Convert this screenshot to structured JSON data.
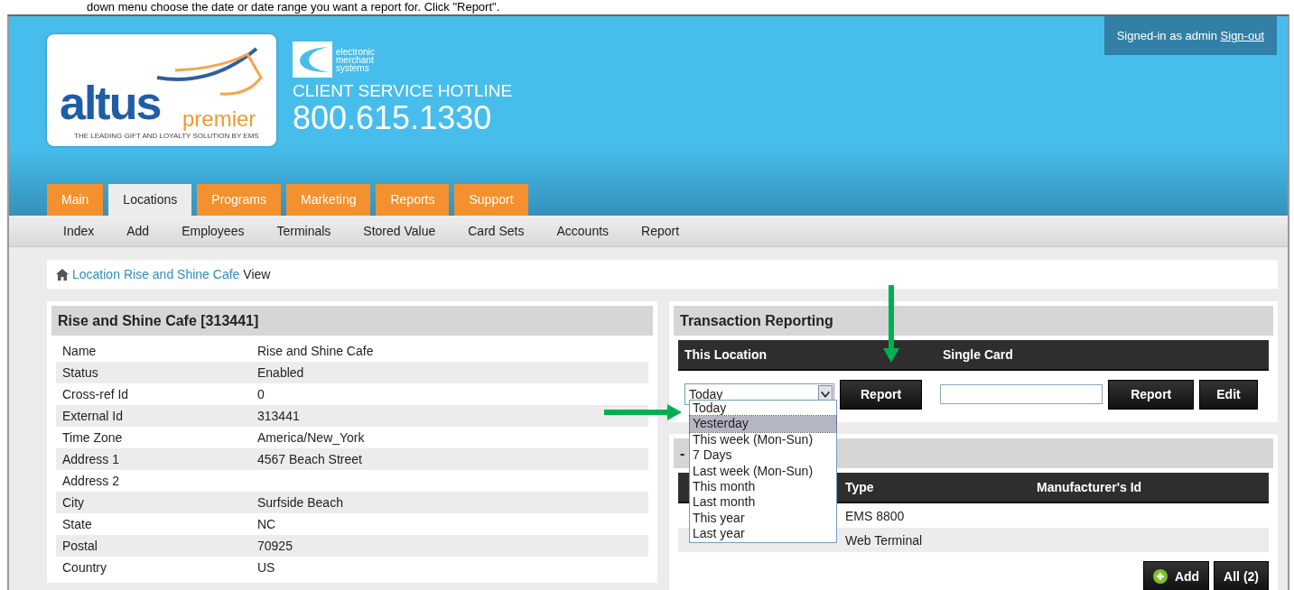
{
  "instruction_line": "down menu choose the date or date range you want a report for. Click \"Report\".",
  "header": {
    "logo": {
      "word": "altus",
      "suffix": "premier",
      "tagline": "THE LEADING GIFT AND LOYALTY SOLUTION BY EMS"
    },
    "partner": {
      "lines": [
        "electronic",
        "merchant",
        "systems"
      ],
      "hotline_label": "CLIENT SERVICE HOTLINE",
      "hotline_number": "800.615.1330"
    },
    "session": {
      "text": "Signed-in as admin",
      "link": "Sign-out"
    }
  },
  "tabs": [
    {
      "label": "Main",
      "selected": false
    },
    {
      "label": "Locations",
      "selected": true
    },
    {
      "label": "Programs",
      "selected": false
    },
    {
      "label": "Marketing",
      "selected": false
    },
    {
      "label": "Reports",
      "selected": false
    },
    {
      "label": "Support",
      "selected": false
    }
  ],
  "subnav": [
    "Index",
    "Add",
    "Employees",
    "Terminals",
    "Stored Value",
    "Card Sets",
    "Accounts",
    "Report"
  ],
  "breadcrumb": {
    "links": [
      "Location",
      "Rise and Shine Cafe"
    ],
    "current": "View"
  },
  "location_panel": {
    "title": "Rise and Shine Cafe [313441]",
    "rows": [
      {
        "label": "Name",
        "value": "Rise and Shine Cafe"
      },
      {
        "label": "Status",
        "value": "Enabled"
      },
      {
        "label": "Cross-ref Id",
        "value": "0"
      },
      {
        "label": "External Id",
        "value": "313441"
      },
      {
        "label": "Time Zone",
        "value": "America/New_York"
      },
      {
        "label": "Address 1",
        "value": "4567 Beach Street"
      },
      {
        "label": "Address 2"
      },
      {
        "label": "City",
        "value": "Surfside Beach"
      },
      {
        "label": "State",
        "value": "NC"
      },
      {
        "label": "Postal",
        "value": "70925"
      },
      {
        "label": "Country",
        "value": "US"
      }
    ]
  },
  "reporting_panel": {
    "title": "Transaction Reporting",
    "sections": [
      "This Location",
      "Single Card"
    ],
    "range_select": {
      "value": "Today",
      "expanded": true,
      "options": [
        {
          "label": "Today",
          "highlighted": false
        },
        {
          "label": "Yesterday",
          "highlighted": true
        },
        {
          "label": "This week (Mon-Sun)",
          "highlighted": false
        },
        {
          "label": "7 Days",
          "highlighted": false
        },
        {
          "label": "Last week (Mon-Sun)",
          "highlighted": false
        },
        {
          "label": "This month",
          "highlighted": false
        },
        {
          "label": "Last month",
          "highlighted": false
        },
        {
          "label": "This year",
          "highlighted": false
        },
        {
          "label": "Last year",
          "highlighted": false
        }
      ]
    },
    "location_button": "Report",
    "card_buttons": [
      "Report",
      "Edit"
    ]
  },
  "terminals_panel": {
    "title": "-",
    "columns": [
      "Type",
      "Manufacturer's Id"
    ],
    "rows": [
      [
        "EMS 8800"
      ],
      [
        "Web Terminal"
      ]
    ],
    "buttons": [
      {
        "kind": "add",
        "label": "Add"
      },
      {
        "kind": "plain",
        "label": "All (2)"
      }
    ]
  }
}
